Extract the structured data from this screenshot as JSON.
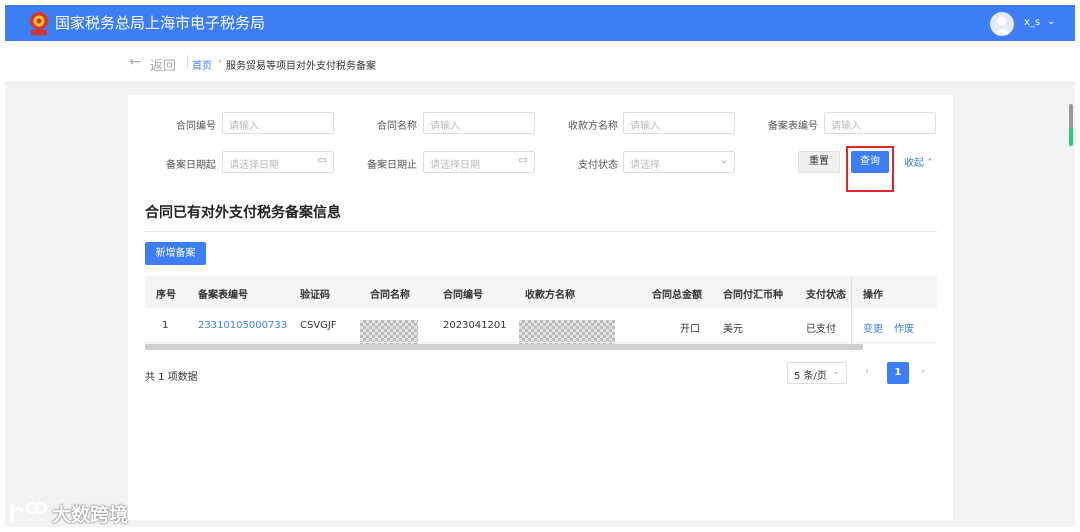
{
  "header": {
    "title": "国家税务总局上海市电子税务局",
    "username": "x_s"
  },
  "breadcrumb": {
    "back": "返回",
    "home": "首页",
    "current": "服务贸易等项目对外支付税务备案"
  },
  "filters": {
    "contract_no": {
      "label": "合同编号",
      "placeholder": "请输入"
    },
    "contract_name": {
      "label": "合同名称",
      "placeholder": "请输入"
    },
    "payee_name": {
      "label": "收款方名称",
      "placeholder": "请输入"
    },
    "record_no": {
      "label": "备案表编号",
      "placeholder": "请输入"
    },
    "date_start": {
      "label": "备案日期起",
      "placeholder": "请选择日期"
    },
    "date_end": {
      "label": "备案日期止",
      "placeholder": "请选择日期"
    },
    "pay_status": {
      "label": "支付状态",
      "placeholder": "请选择"
    },
    "reset": "重置",
    "query": "查询",
    "collapse": "收起"
  },
  "section": {
    "title": "合同已有对外支付税务备案信息",
    "add_button": "新增备案"
  },
  "table": {
    "columns": [
      "序号",
      "备案表编号",
      "验证码",
      "合同名称",
      "合同编号",
      "收款方名称",
      "合同总金额",
      "合同付汇币种",
      "支付状态",
      "操作"
    ],
    "rows": [
      {
        "index": "1",
        "record_no": "23310105000733",
        "verify_code": "CSVGJF",
        "contract_no": "2023041201",
        "amount": "开口",
        "currency": "美元",
        "status": "已支付",
        "action_change": "变更",
        "action_void": "作废"
      }
    ]
  },
  "pagination": {
    "total": "共 1 项数据",
    "page_size": "5 条/页",
    "current_page": "1"
  },
  "watermark": {
    "text": "大数跨境"
  },
  "colors": {
    "primary": "#3d7ef5",
    "highlight": "#e0262d",
    "background": "#f2f3f5"
  }
}
